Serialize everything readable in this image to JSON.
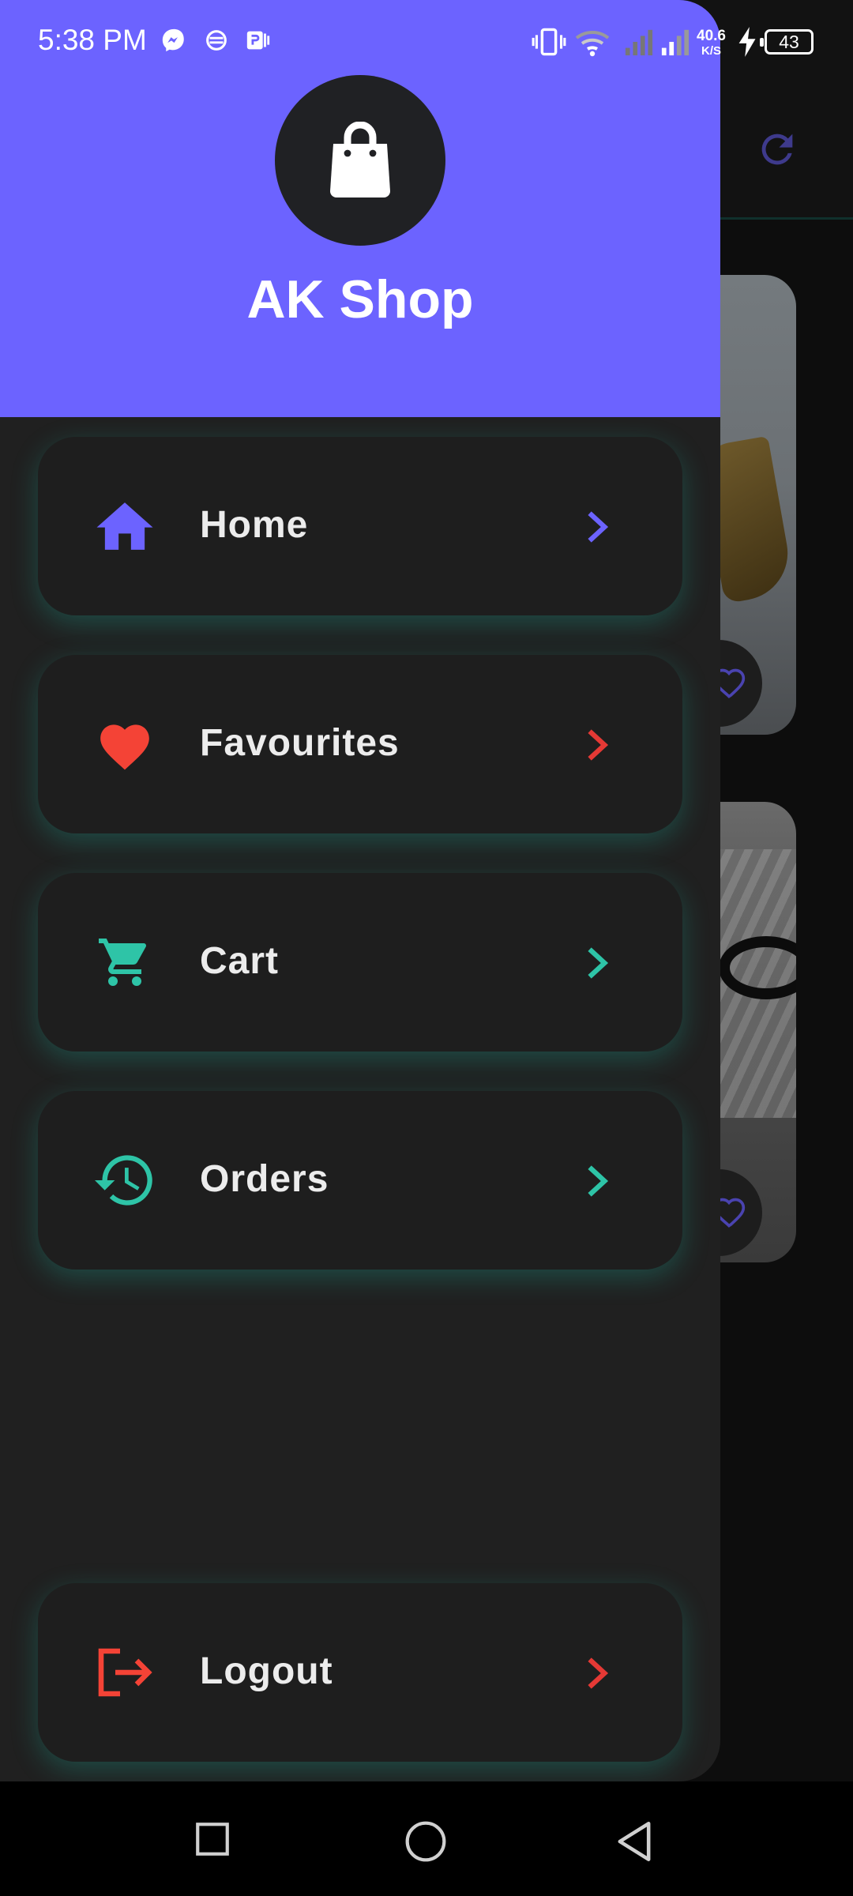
{
  "status_bar": {
    "time": "5:38 PM",
    "net_speed_value": "40.6",
    "net_speed_unit": "K/S",
    "battery": "43"
  },
  "drawer": {
    "title": "AK Shop",
    "logo_icon": "shopping-bag-icon",
    "items": [
      {
        "label": "Home",
        "icon": "home-icon",
        "color": "#6c63ff"
      },
      {
        "label": "Favourites",
        "icon": "heart-icon",
        "color": "#f44336"
      },
      {
        "label": "Cart",
        "icon": "cart-icon",
        "color": "#2ec4a7"
      },
      {
        "label": "Orders",
        "icon": "history-icon",
        "color": "#2ec4a7"
      }
    ],
    "logout": {
      "label": "Logout",
      "icon": "logout-icon",
      "color": "#f44336"
    }
  },
  "colors": {
    "accent": "#6c63ff",
    "drawer_bg": "#202020",
    "card_bg": "#1e1e1e",
    "glow": "#1dbeaa"
  }
}
